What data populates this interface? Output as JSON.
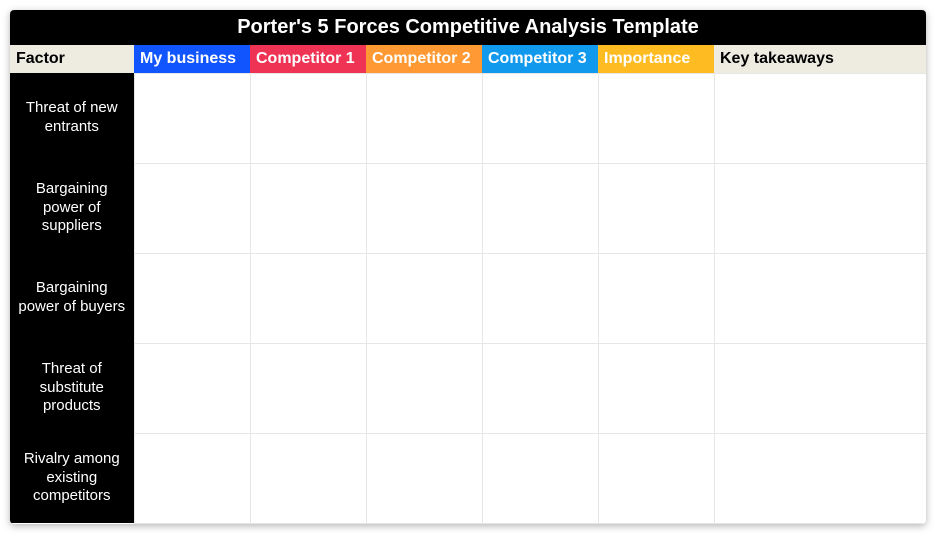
{
  "title": "Porter's 5 Forces Competitive Analysis Template",
  "headers": {
    "factor": "Factor",
    "my_business": "My business",
    "competitor1": "Competitor 1",
    "competitor2": "Competitor 2",
    "competitor3": "Competitor 3",
    "importance": "Importance",
    "takeaways": "Key takeaways"
  },
  "rows": [
    {
      "label": "Threat of new entrants",
      "my_business": "",
      "competitor1": "",
      "competitor2": "",
      "competitor3": "",
      "importance": "",
      "takeaways": ""
    },
    {
      "label": "Bargaining power of suppliers",
      "my_business": "",
      "competitor1": "",
      "competitor2": "",
      "competitor3": "",
      "importance": "",
      "takeaways": ""
    },
    {
      "label": "Bargaining power of buyers",
      "my_business": "",
      "competitor1": "",
      "competitor2": "",
      "competitor3": "",
      "importance": "",
      "takeaways": ""
    },
    {
      "label": "Threat of substitute products",
      "my_business": "",
      "competitor1": "",
      "competitor2": "",
      "competitor3": "",
      "importance": "",
      "takeaways": ""
    },
    {
      "label": "Rivalry among existing competitors",
      "my_business": "",
      "competitor1": "",
      "competitor2": "",
      "competitor3": "",
      "importance": "",
      "takeaways": ""
    }
  ]
}
